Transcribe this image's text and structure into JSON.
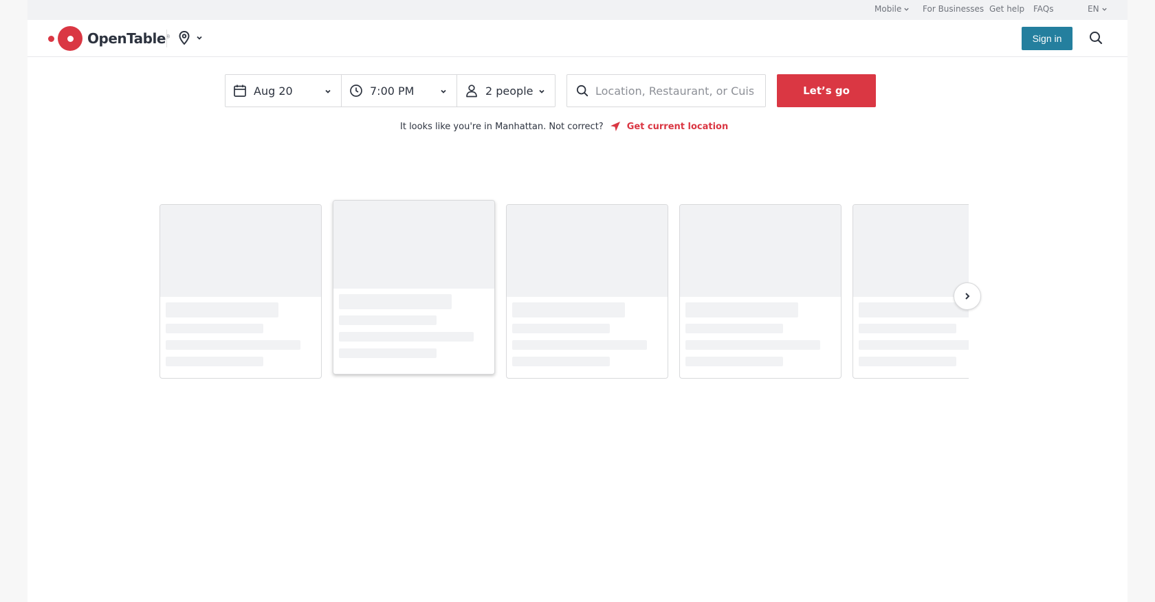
{
  "utility_bar": {
    "mobile": "Mobile",
    "for_businesses": "For Businesses",
    "get_help": "Get help",
    "faqs": "FAQs",
    "language": "EN"
  },
  "header": {
    "logo_text": "OpenTable",
    "logo_mark": "®",
    "sign_in": "Sign in"
  },
  "search": {
    "date": "Aug 20",
    "time": "7:00 PM",
    "party_size": "2 people",
    "query_placeholder": "Location, Restaurant, or Cuisine",
    "submit": "Let’s go"
  },
  "location_notice": {
    "text": "It looks like you're in Manhattan. Not correct?",
    "action": "Get current location"
  },
  "colors": {
    "brand_red": "#da3743",
    "sign_in_blue": "#247f9e",
    "skeleton": "#f1f2f4"
  },
  "icons": {
    "location": "map-pin-icon",
    "search": "magnifier-icon",
    "date": "calendar-icon",
    "time": "clock-icon",
    "party": "person-icon",
    "locate": "navigation-arrow-icon",
    "next": "chevron-right-icon"
  },
  "carousel": {
    "state": "loading",
    "placeholder_cards": 5
  }
}
